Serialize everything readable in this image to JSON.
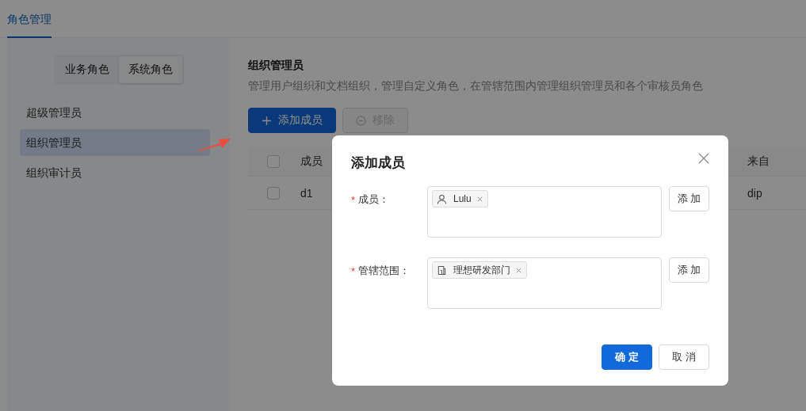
{
  "tabs": [
    {
      "label": "角色管理",
      "selected": true
    }
  ],
  "role_types": [
    {
      "label": "业务角色",
      "selected": false
    },
    {
      "label": "系统角色",
      "selected": true
    }
  ],
  "roles": [
    {
      "label": "超级管理员",
      "selected": false
    },
    {
      "label": "组织管理员",
      "selected": true
    },
    {
      "label": "组织审计员",
      "selected": false
    }
  ],
  "detail": {
    "title": "组织管理员",
    "description": "管理用户组织和文档组织，管理自定义角色，在管辖范围内管理组织管理员和各个审核员角色",
    "actions": [
      {
        "label": "添加成员",
        "kind": "primary",
        "disabled": false
      },
      {
        "label": "移除",
        "kind": "remove",
        "disabled": true
      }
    ],
    "table": {
      "all_checked": false,
      "columns": [
        "成员",
        "来自"
      ],
      "rows": [
        {
          "checked": false,
          "cells": [
            "d1",
            "dip"
          ]
        }
      ]
    }
  },
  "dialog": {
    "title": "添加成员",
    "required_mark": "*",
    "fields": [
      {
        "label": "成员：",
        "required": true,
        "tags": [
          {
            "kind": "user",
            "label": "Lulu"
          }
        ],
        "button": "添 加"
      },
      {
        "label": "管辖范围：",
        "required": true,
        "tags": [
          {
            "kind": "department",
            "label": "理想研发部门"
          }
        ],
        "button": "添 加"
      }
    ],
    "buttons": [
      {
        "label": "确 定",
        "kind": "primary"
      },
      {
        "label": "取 消",
        "kind": "default"
      }
    ]
  }
}
